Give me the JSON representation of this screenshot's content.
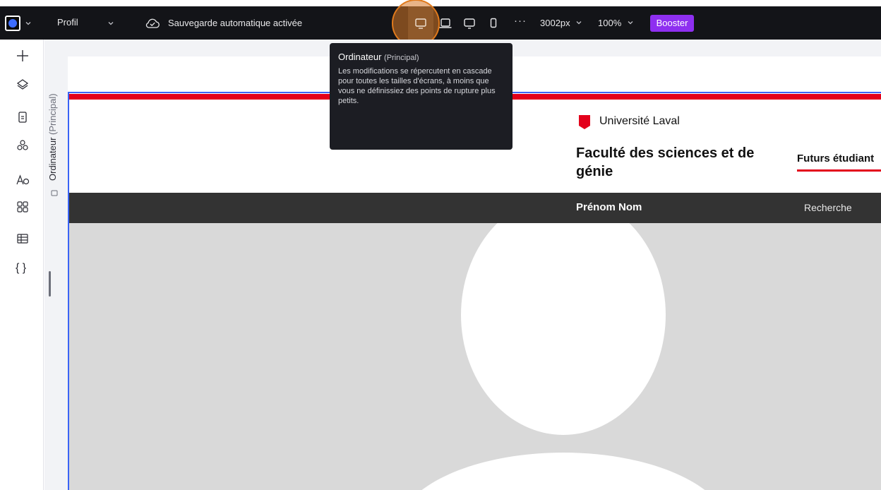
{
  "topbar": {
    "profile_label": "Profil",
    "autosave_label": "Sauvegarde automatique activée",
    "more_label": "···",
    "width_value": "3002px",
    "zoom_value": "100%",
    "booster_label": "Booster",
    "booster_color": "#8e2ff0",
    "breakpoints": [
      {
        "icon": "desktop-icon",
        "active": true
      },
      {
        "icon": "laptop-icon",
        "active": false
      },
      {
        "icon": "tablet-landscape-icon",
        "active": false
      },
      {
        "icon": "mobile-icon",
        "active": false
      }
    ]
  },
  "rail": {
    "items": [
      {
        "icon": "add-icon"
      },
      {
        "icon": "layers-icon"
      },
      {
        "icon": "page-icon"
      },
      {
        "icon": "components-icon"
      },
      {
        "icon": "typography-icon"
      },
      {
        "icon": "apps-grid-icon"
      },
      {
        "icon": "table-icon"
      },
      {
        "icon": "code-icon",
        "label": "{ }"
      }
    ]
  },
  "canvas": {
    "breakpoint_label": "Ordinateur",
    "breakpoint_sub": "(Principal)"
  },
  "site": {
    "university": "Université Laval",
    "faculty": "Faculté des sciences et de génie",
    "futurs": "Futurs étudiant",
    "nav_name": "Prénom  Nom",
    "nav_search": "Recherche",
    "accent_red": "#e3001b"
  },
  "tooltip": {
    "title": "Ordinateur",
    "title_sub": "(Principal)",
    "body": "Les modifications se répercutent en cascade pour toutes les tailles d'écrans, à moins que vous ne définissiez des points de rupture plus petits."
  }
}
